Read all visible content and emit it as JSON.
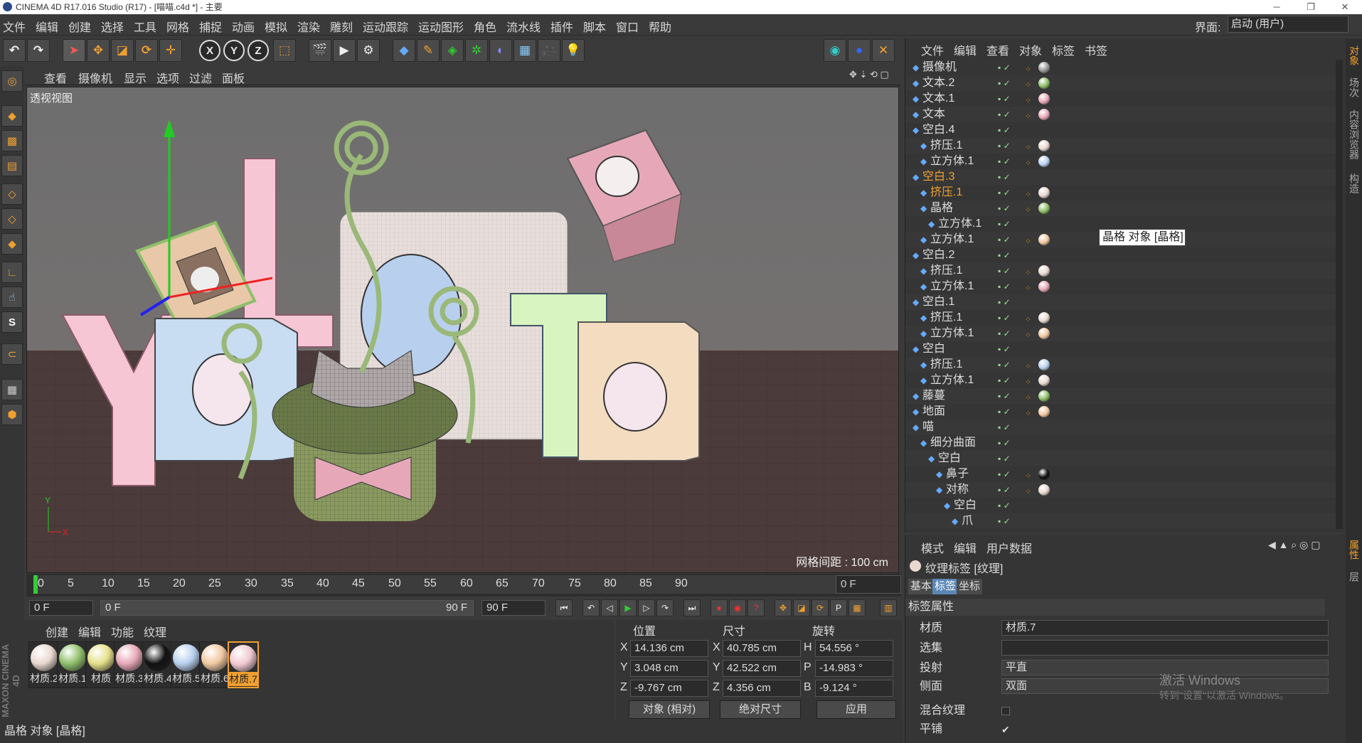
{
  "window": {
    "title": "CINEMA 4D R17.016 Studio (R17) - [喵喵.c4d *] - 主要"
  },
  "menu": [
    "文件",
    "编辑",
    "创建",
    "选择",
    "工具",
    "网格",
    "捕捉",
    "动画",
    "模拟",
    "渲染",
    "雕刻",
    "运动跟踪",
    "运动图形",
    "角色",
    "流水线",
    "插件",
    "脚本",
    "窗口",
    "帮助"
  ],
  "layout": {
    "label": "界面:",
    "value": "启动 (用户)"
  },
  "viewport": {
    "menu": [
      "查看",
      "摄像机",
      "显示",
      "选项",
      "过滤",
      "面板"
    ],
    "label": "透视视图",
    "grid_spacing": "网格间距 : 100 cm"
  },
  "timeline": {
    "ticks": [
      "0",
      "5",
      "10",
      "15",
      "20",
      "25",
      "30",
      "35",
      "40",
      "45",
      "50",
      "55",
      "60",
      "65",
      "70",
      "75",
      "80",
      "85",
      "90"
    ],
    "current": "0 F",
    "start": "0 F",
    "range_start": "0 F",
    "range_end": "90 F",
    "end": "90 F"
  },
  "materials": {
    "menu": [
      "创建",
      "编辑",
      "功能",
      "纹理"
    ],
    "items": [
      {
        "name": "材质.2",
        "color": "#e8d8d0"
      },
      {
        "name": "材质.1",
        "color": "#8fbf6a"
      },
      {
        "name": "材质",
        "color": "#e6e08a"
      },
      {
        "name": "材质.3",
        "color": "#e8a8b8"
      },
      {
        "name": "材质.4",
        "color": "#111111"
      },
      {
        "name": "材质.5",
        "color": "#b8d0ee"
      },
      {
        "name": "材质.6",
        "color": "#f0c8a0"
      },
      {
        "name": "材质.7",
        "color": "#f0c8d0"
      }
    ],
    "selected": 7
  },
  "coords": {
    "headers": [
      "位置",
      "尺寸",
      "旋转"
    ],
    "rows": [
      {
        "l1": "X",
        "v1": "14.136 cm",
        "l2": "X",
        "v2": "40.785 cm",
        "l3": "H",
        "v3": "54.556 °"
      },
      {
        "l1": "Y",
        "v1": "3.048 cm",
        "l2": "Y",
        "v2": "42.522 cm",
        "l3": "P",
        "v3": "-14.983 °"
      },
      {
        "l1": "Z",
        "v1": "-9.767 cm",
        "l2": "Z",
        "v2": "4.356 cm",
        "l3": "B",
        "v3": "-9.124 °"
      }
    ],
    "mode1": "对象 (相对)",
    "mode2": "绝对尺寸",
    "apply": "应用"
  },
  "status": "晶格 对象 [晶格]",
  "brand": "MAXON CINEMA 4D",
  "objects": {
    "menu": [
      "文件",
      "编辑",
      "查看",
      "对象",
      "标签",
      "书签"
    ],
    "rows": [
      {
        "name": "摄像机",
        "indent": 0,
        "tags": [
          "#999"
        ]
      },
      {
        "name": "文本.2",
        "indent": 0,
        "tags": [
          "#8fbf6a"
        ]
      },
      {
        "name": "文本.1",
        "indent": 0,
        "tags": [
          "#e8a8b8"
        ]
      },
      {
        "name": "文本",
        "indent": 0,
        "tags": [
          "#e8a8b8"
        ]
      },
      {
        "name": "空白.4",
        "indent": 0,
        "tags": []
      },
      {
        "name": "挤压.1",
        "indent": 1,
        "tags": [
          "#e8d8d0"
        ]
      },
      {
        "name": "立方体.1",
        "indent": 1,
        "tags": [
          "#b8d0ee"
        ]
      },
      {
        "name": "空白.3",
        "indent": 0,
        "tags": [],
        "sel": true
      },
      {
        "name": "挤压.1",
        "indent": 1,
        "tags": [
          "#e8d8d0"
        ],
        "sel": true
      },
      {
        "name": "晶格",
        "indent": 1,
        "tags": [
          "#8fbf6a"
        ]
      },
      {
        "name": "立方体.1",
        "indent": 2,
        "tags": []
      },
      {
        "name": "立方体.1",
        "indent": 1,
        "tags": [
          "#f0c8a0"
        ]
      },
      {
        "name": "空白.2",
        "indent": 0,
        "tags": []
      },
      {
        "name": "挤压.1",
        "indent": 1,
        "tags": [
          "#e8d8d0"
        ]
      },
      {
        "name": "立方体.1",
        "indent": 1,
        "tags": [
          "#e8a8b8"
        ]
      },
      {
        "name": "空白.1",
        "indent": 0,
        "tags": []
      },
      {
        "name": "挤压.1",
        "indent": 1,
        "tags": [
          "#e8d8d0"
        ]
      },
      {
        "name": "立方体.1",
        "indent": 1,
        "tags": [
          "#f0c8a0"
        ]
      },
      {
        "name": "空白",
        "indent": 0,
        "tags": []
      },
      {
        "name": "挤压.1",
        "indent": 1,
        "tags": [
          "#b8d0ee"
        ]
      },
      {
        "name": "立方体.1",
        "indent": 1,
        "tags": [
          "#e8d8d0"
        ]
      },
      {
        "name": "藤蔓",
        "indent": 0,
        "tags": [
          "#8fbf6a"
        ]
      },
      {
        "name": "地面",
        "indent": 0,
        "tags": [
          "#f0c8a0"
        ]
      },
      {
        "name": "喵",
        "indent": 0,
        "tags": []
      },
      {
        "name": "细分曲面",
        "indent": 1,
        "tags": []
      },
      {
        "name": "空白",
        "indent": 2,
        "tags": []
      },
      {
        "name": "鼻子",
        "indent": 3,
        "tags": [
          "#111111"
        ]
      },
      {
        "name": "对称",
        "indent": 3,
        "tags": [
          "#e8d8d0"
        ]
      },
      {
        "name": "空白",
        "indent": 4,
        "tags": []
      },
      {
        "name": "爪",
        "indent": 5,
        "tags": []
      }
    ],
    "tooltip": "晶格 对象 [晶格]"
  },
  "attributes": {
    "menu": [
      "模式",
      "编辑",
      "用户数据"
    ],
    "title": "纹理标签 [纹理]",
    "tabs": [
      "基本",
      "标签",
      "坐标"
    ],
    "active_tab": 1,
    "section": "标签属性",
    "fields": [
      {
        "label": "材质",
        "value": "材质.7"
      },
      {
        "label": "选集",
        "value": ""
      },
      {
        "label": "投射",
        "value": "平直"
      },
      {
        "label": "侧面",
        "value": "双面"
      }
    ],
    "mix_label": "混合纹理",
    "tile_label": "平铺",
    "tile_check": "✔"
  },
  "right_tabs": [
    "对象",
    "场次",
    "内容浏览器",
    "构造"
  ],
  "right_tabs_lower": [
    "属性",
    "层"
  ],
  "watermark": {
    "line1": "激活 Windows",
    "line2": "转到\"设置\"以激活 Windows。"
  }
}
